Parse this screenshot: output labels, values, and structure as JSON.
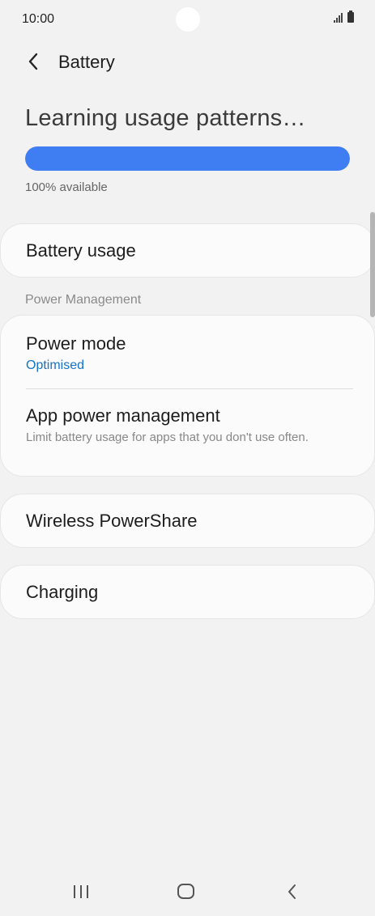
{
  "status_bar": {
    "time": "10:00"
  },
  "header": {
    "title": "Battery"
  },
  "battery": {
    "status_text": "Learning usage patterns…",
    "level_percent": 100,
    "available_text": "100% available",
    "accent_color": "#3e7df2"
  },
  "items": {
    "battery_usage": "Battery usage",
    "section_label": "Power Management",
    "power_mode": {
      "label": "Power mode",
      "value": "Optimised"
    },
    "app_power": {
      "label": "App power management",
      "description": "Limit battery usage for apps that you don't use often."
    },
    "wireless_powershare": "Wireless PowerShare",
    "charging": "Charging"
  },
  "nav": {
    "icons": [
      "recent-apps-icon",
      "home-icon",
      "back-icon"
    ]
  }
}
